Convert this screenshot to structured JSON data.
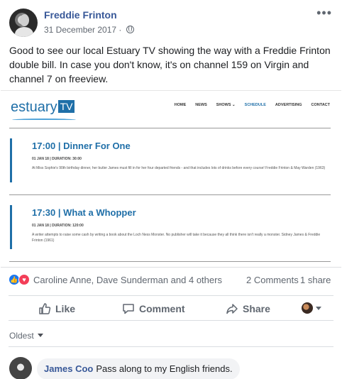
{
  "post": {
    "author": "Freddie Frinton",
    "date": "31 December 2017",
    "separator": "·",
    "privacy_icon": "globe-icon",
    "more_icon": "more-icon",
    "text": "Good to see our local Estuary TV showing the way with a Freddie Frinton double bill. In case you don't know, it's on channel 159 on Virgin and channel 7 on freeview."
  },
  "embed": {
    "logo_text": "estuary",
    "logo_tv": "TV",
    "nav": [
      "HOME",
      "NEWS",
      "SHOWS ⌄",
      "SCHEDULE",
      "ADVERTISING",
      "CONTACT"
    ],
    "programmes": [
      {
        "title": "17:00 | Dinner For One",
        "when": "01 JAN 18 | DURATION: 30:00",
        "description": "At Miss Sophie's 90th birthday dinner, her butler James must fill in for her four departed friends - and that includes lots of drinks before every course! Freddie Frinton & May Warden (1963)"
      },
      {
        "title": "17:30 | What a Whopper",
        "when": "01 JAN 18 | DURATION: 120:00",
        "description": "A writer attempts to raise some cash by writing a book about the Loch Ness Monster. No publisher will take it because they all think there isn't really a monster. Sidney James & Freddie Frinton (1961)"
      }
    ]
  },
  "reactions": {
    "names": "Caroline Anne, Dave Sunderman and 4 others",
    "comments": "2 Comments",
    "shares": "1 share",
    "colors": {
      "like": "#1877f2",
      "love": "#f33e58"
    }
  },
  "actions": {
    "like": "Like",
    "comment": "Comment",
    "share": "Share"
  },
  "comments": {
    "sort_label": "Oldest",
    "items": [
      {
        "author": "James Coo",
        "text": "Pass along to my English friends."
      }
    ]
  }
}
